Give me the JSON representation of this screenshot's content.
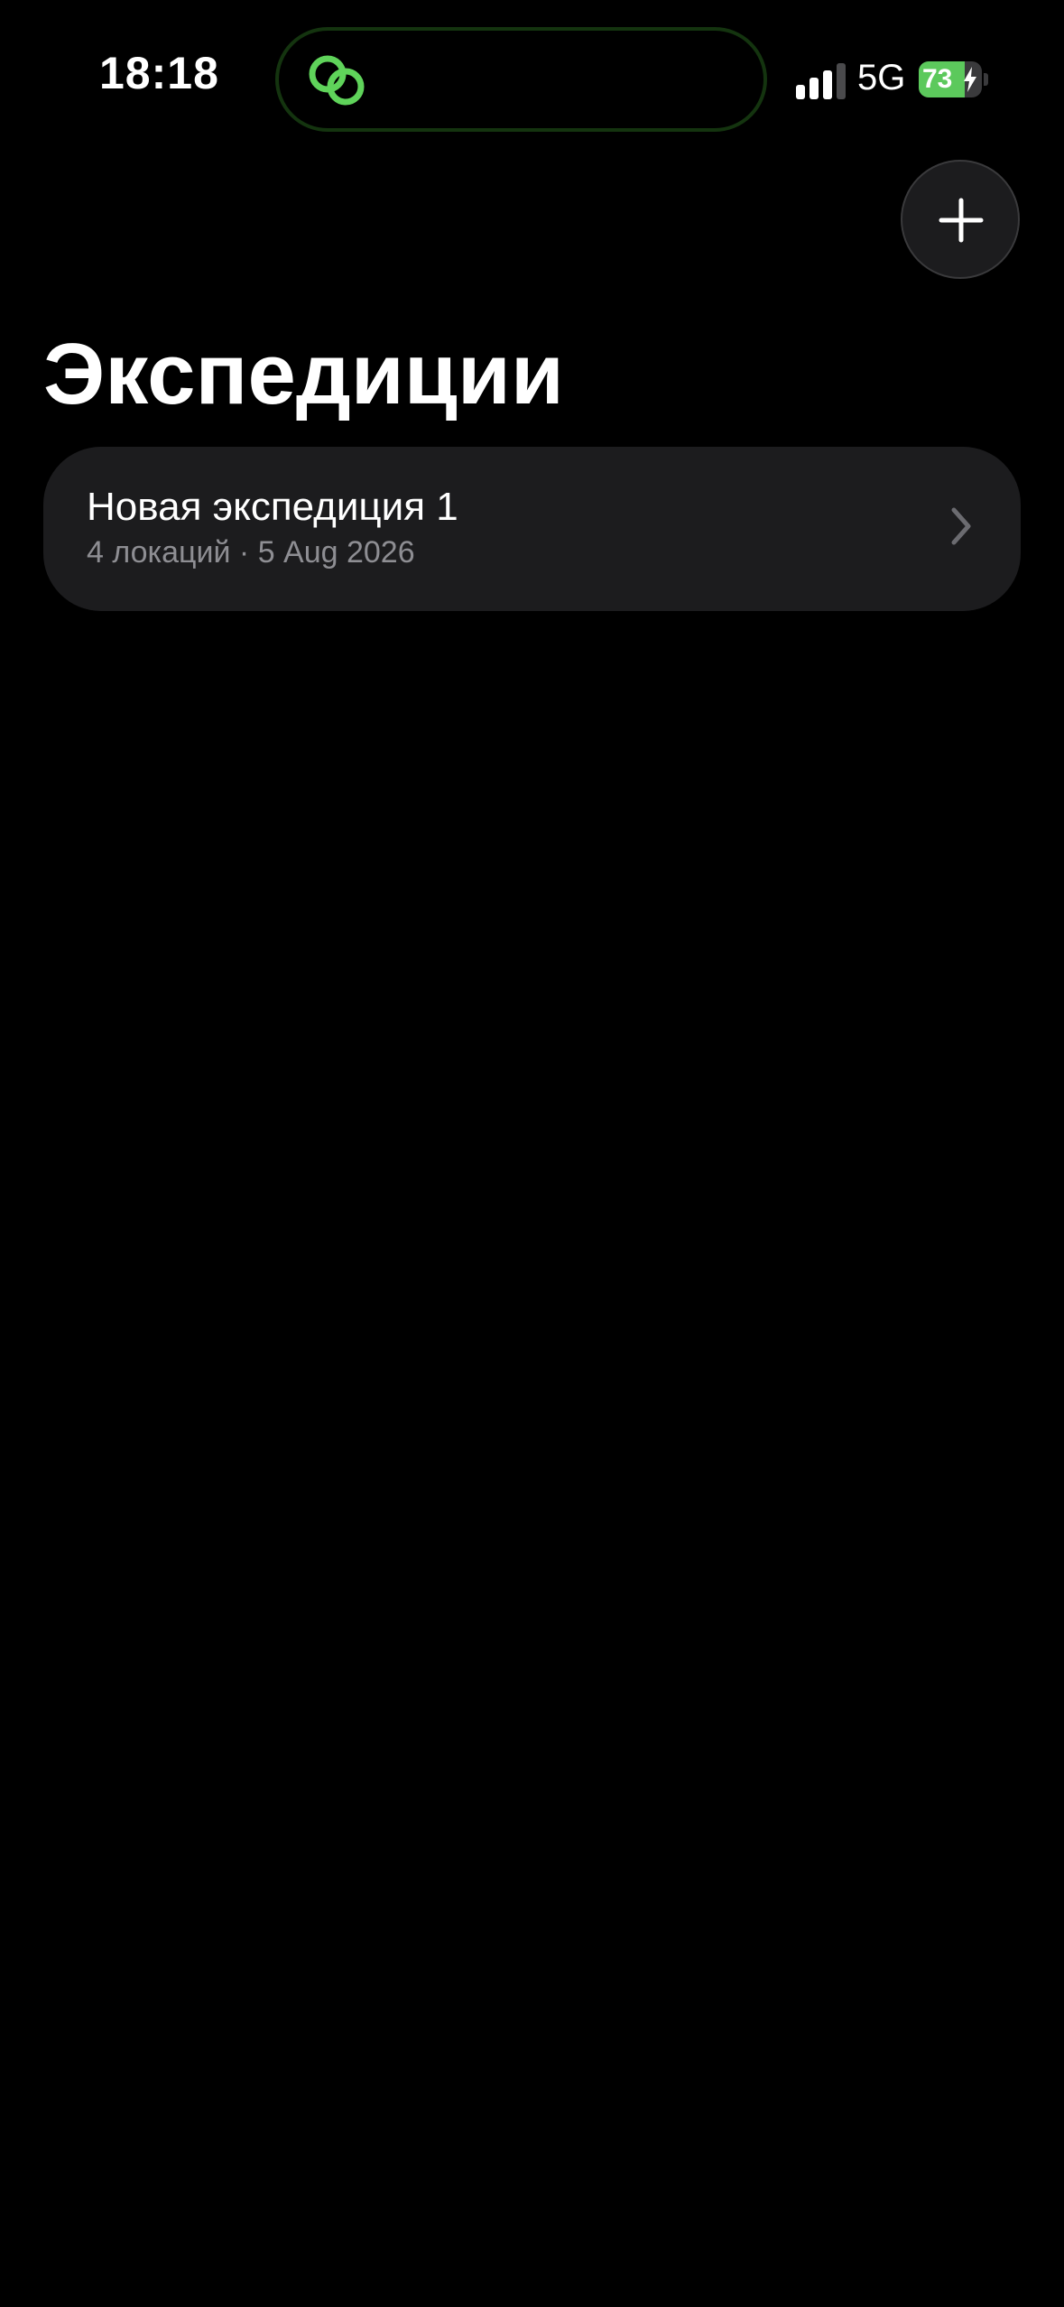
{
  "status_bar": {
    "time": "18:18",
    "network": "5G",
    "battery_level": "73",
    "battery_fraction": 0.73,
    "island_icon": "link-rings-icon",
    "island_color": "#5fd35a"
  },
  "header": {
    "add_icon": "plus-icon"
  },
  "page": {
    "title": "Экспедиции"
  },
  "expeditions": [
    {
      "title": "Новая экспедиция 1",
      "subtitle": "4 локаций · 5 Aug 2026",
      "chevron_icon": "chevron-right-icon"
    }
  ],
  "colors": {
    "background": "#000000",
    "card": "#1c1c1e",
    "secondary_text": "#8e8e93",
    "battery_green": "#5cc95c"
  }
}
